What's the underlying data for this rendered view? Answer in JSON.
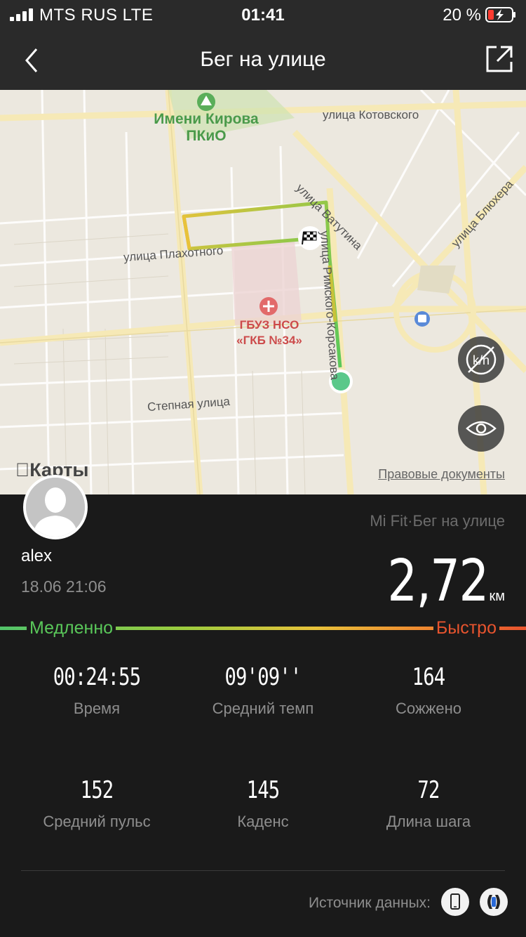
{
  "status_bar": {
    "carrier": "MTS RUS  LTE",
    "time": "01:41",
    "battery": "20 %"
  },
  "nav": {
    "title": "Бег на улице"
  },
  "map": {
    "park_label": "Имени Кирова ПКиО",
    "streets": {
      "kotovskogo": "улица Котовского",
      "vatutina": "улица Ватутина",
      "blyukhera": "улица Блюхера",
      "plakhotnogo": "улица Плахотного",
      "stepnaya": "Степная улица",
      "rimskogo_korsakova": "улица Римского-Корсакова"
    },
    "hospital_label": "ГБУЗ НСО «ГКБ №34»",
    "maps_logo": "Карты",
    "legal_link": "Правовые документы"
  },
  "activity": {
    "username": "alex",
    "datetime": "18.06 21:06",
    "source": "Mi Fit·Бег на улице",
    "distance_value": "2,72",
    "distance_unit": "км"
  },
  "speed_scale": {
    "slow": "Медленно",
    "fast": "Быстро"
  },
  "stats": [
    {
      "value": "00:24:55",
      "label": "Время"
    },
    {
      "value": "09'09''",
      "label": "Средний темп"
    },
    {
      "value": "164",
      "label": "Сожжено"
    },
    {
      "value": "152",
      "label": "Средний пульс"
    },
    {
      "value": "145",
      "label": "Каденс"
    },
    {
      "value": "72",
      "label": "Длина шага"
    }
  ],
  "footer": {
    "data_source_label": "Источник данных:"
  },
  "colors": {
    "background": "#1a1a1a",
    "header": "#2a2a2a",
    "slow": "#5ac85a",
    "fast": "#e8542e",
    "route_start": "#5ac88a"
  }
}
